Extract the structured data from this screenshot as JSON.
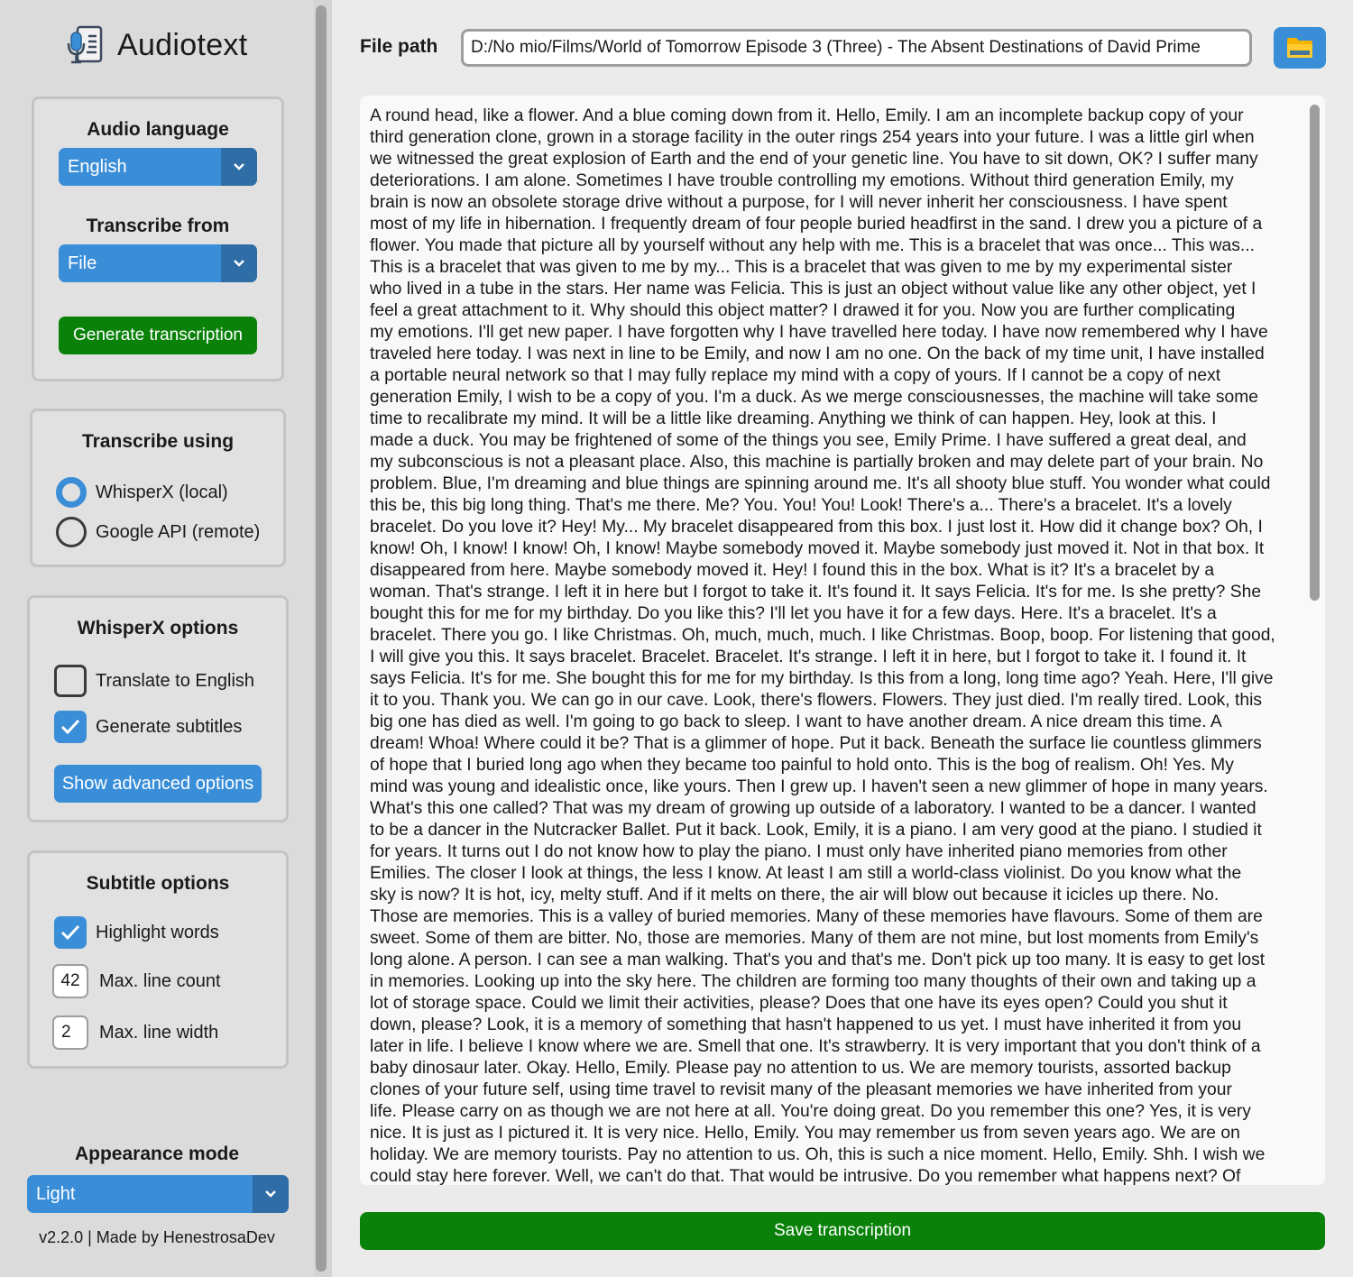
{
  "app": {
    "title": "Audiotext",
    "version": "v2.2.0 | Made by HenestrosaDev"
  },
  "audio_section": {
    "language_title": "Audio language",
    "language_value": "English",
    "transcribe_from_title": "Transcribe from",
    "transcribe_from_value": "File",
    "generate_label": "Generate transcription"
  },
  "transcribe_using": {
    "title": "Transcribe using",
    "options": [
      {
        "label": "WhisperX (local)",
        "selected": true
      },
      {
        "label": "Google API (remote)",
        "selected": false
      }
    ]
  },
  "whisperx_options": {
    "title": "WhisperX options",
    "translate_label": "Translate to English",
    "translate_checked": false,
    "subtitles_label": "Generate subtitles",
    "subtitles_checked": true,
    "advanced_label": "Show advanced options"
  },
  "subtitle_options": {
    "title": "Subtitle options",
    "highlight_label": "Highlight words",
    "highlight_checked": true,
    "line_count_value": "42",
    "line_count_label": "Max. line count",
    "line_width_value": "2",
    "line_width_label": "Max. line width"
  },
  "appearance": {
    "title": "Appearance mode",
    "value": "Light"
  },
  "file_path": {
    "label": "File path",
    "value": "D:/No mio/Films/World of Tomorrow Episode 3 (Three) - The Absent Destinations of David Prime"
  },
  "transcription": {
    "lines": [
      "A round head, like a flower. And a blue coming down from it. Hello, Emily. I am an incomplete backup copy of your",
      "third generation clone, grown in a storage facility in the outer rings 254 years into your future. I was a little girl when",
      "we witnessed the great explosion of Earth and the end of your genetic line. You have to sit down, OK? I suffer many",
      "deteriorations. I am alone. Sometimes I have trouble controlling my emotions. Without third generation Emily, my",
      "brain is now an obsolete storage drive without a purpose, for I will never inherit her consciousness. I have spent",
      "most of my life in hibernation. I frequently dream of four people buried headfirst in the sand. I drew you a picture of a",
      "flower. You made that picture all by yourself without any help with me. This is a bracelet that was once... This was...",
      "This is a bracelet that was given to me by my... This is a bracelet that was given to me by my experimental sister",
      "who lived in a tube in the stars. Her name was Felicia. This is just an object without value like any other object, yet I",
      "feel a great attachment to it. Why should this object matter? I drawed it for you. Now you are further complicating",
      "my emotions. I'll get new paper. I have forgotten why I have travelled here today. I have now remembered why I have",
      "traveled here today. I was next in line to be Emily, and now I am no one. On the back of my time unit, I have installed",
      "a portable neural network so that I may fully replace my mind with a copy of yours. If I cannot be a copy of next",
      "generation Emily, I wish to be a copy of you. I'm a duck. As we merge consciousnesses, the machine will take some",
      "time to recalibrate my mind. It will be a little like dreaming. Anything we think of can happen. Hey, look at this. I",
      "made a duck. You may be frightened of some of the things you see, Emily Prime. I have suffered a great deal, and",
      "my subconscious is not a pleasant place. Also, this machine is partially broken and may delete part of your brain. No",
      "problem. Blue, I'm dreaming and blue things are spinning around me. It's all shooty blue stuff. You wonder what could",
      "this be, this big long thing. That's me there. Me? You. You! You! Look! There's a... There's a bracelet. It's a lovely",
      "bracelet. Do you love it? Hey! My... My bracelet disappeared from this box. I just lost it. How did it change box? Oh, I",
      "know! Oh, I know! I know! Oh, I know! Maybe somebody moved it. Maybe somebody just moved it. Not in that box. It",
      "disappeared from here. Maybe somebody moved it. Hey! I found this in the box. What is it? It's a bracelet by a",
      "woman. That's strange. I left it in here but I forgot to take it. It's found it. It says Felicia. It's for me. Is she pretty? She",
      "bought this for me for my birthday. Do you like this? I'll let you have it for a few days. Here. It's a bracelet. It's a",
      "bracelet. There you go. I like Christmas. Oh, much, much, much. I like Christmas. Boop, boop. For listening that good,",
      "I will give you this. It says bracelet. Bracelet. Bracelet. It's strange. I left it in here, but I forgot to take it. I found it. It",
      "says Felicia. It's for me. She bought this for me for my birthday. Is this from a long, long time ago? Yeah. Here, I'll give",
      "it to you. Thank you. We can go in our cave. Look, there's flowers. Flowers. They just died. I'm really tired. Look, this",
      "big one has died as well. I'm going to go back to sleep. I want to have another dream. A nice dream this time. A",
      "dream! Whoa! Where could it be? That is a glimmer of hope. Put it back. Beneath the surface lie countless glimmers",
      "of hope that I buried long ago when they became too painful to hold onto. This is the bog of realism. Oh! Yes. My",
      "mind was young and idealistic once, like yours. Then I grew up. I haven't seen a new glimmer of hope in many years.",
      "What's this one called? That was my dream of growing up outside of a laboratory. I wanted to be a dancer. I wanted",
      "to be a dancer in the Nutcracker Ballet. Put it back. Look, Emily, it is a piano. I am very good at the piano. I studied it",
      "for years. It turns out I do not know how to play the piano. I must only have inherited piano memories from other",
      "Emilies. The closer I look at things, the less I know. At least I am still a world-class violinist. Do you know what the",
      "sky is now? It is hot, icy, melty stuff. And if it melts on there, the air will blow out because it icicles up there. No.",
      "Those are memories. This is a valley of buried memories. Many of these memories have flavours. Some of them are",
      "sweet. Some of them are bitter. No, those are memories. Many of them are not mine, but lost moments from Emily's",
      "long alone. A person. I can see a man walking. That's you and that's me. Don't pick up too many. It is easy to get lost",
      "in memories. Looking up into the sky here. The children are forming too many thoughts of their own and taking up a",
      "lot of storage space. Could we limit their activities, please? Does that one have its eyes open? Could you shut it",
      "down, please? Look, it is a memory of something that hasn't happened to us yet. I must have inherited it from you",
      "later in life. I believe I know where we are. Smell that one. It's strawberry. It is very important that you don't think of a",
      "baby dinosaur later. Okay. Hello, Emily. Please pay no attention to us. We are memory tourists, assorted backup",
      "clones of your future self, using time travel to revisit many of the pleasant memories we have inherited from your",
      "life. Please carry on as though we are not here at all. You're doing great. Do you remember this one? Yes, it is very",
      "nice. It is just as I pictured it. It is very nice. Hello, Emily. You may remember us from seven years ago. We are on",
      "holiday. We are memory tourists. Pay no attention to us. Oh, this is such a nice moment. Hello, Emily. Shh. I wish we",
      "could stay here forever. Well, we can't do that. That would be intrusive. Do you remember what happens next? Of"
    ]
  },
  "save_label": "Save transcription",
  "colors": {
    "accent_blue": "#3a8ed8",
    "accent_green": "#0a820a",
    "sidebar_bg": "#dbdbdb"
  },
  "icons": {
    "logo": "microphone-document-icon",
    "folder": "folder-icon",
    "dropdown": "chevron-down-icon",
    "checkmark": "checkmark-icon"
  }
}
